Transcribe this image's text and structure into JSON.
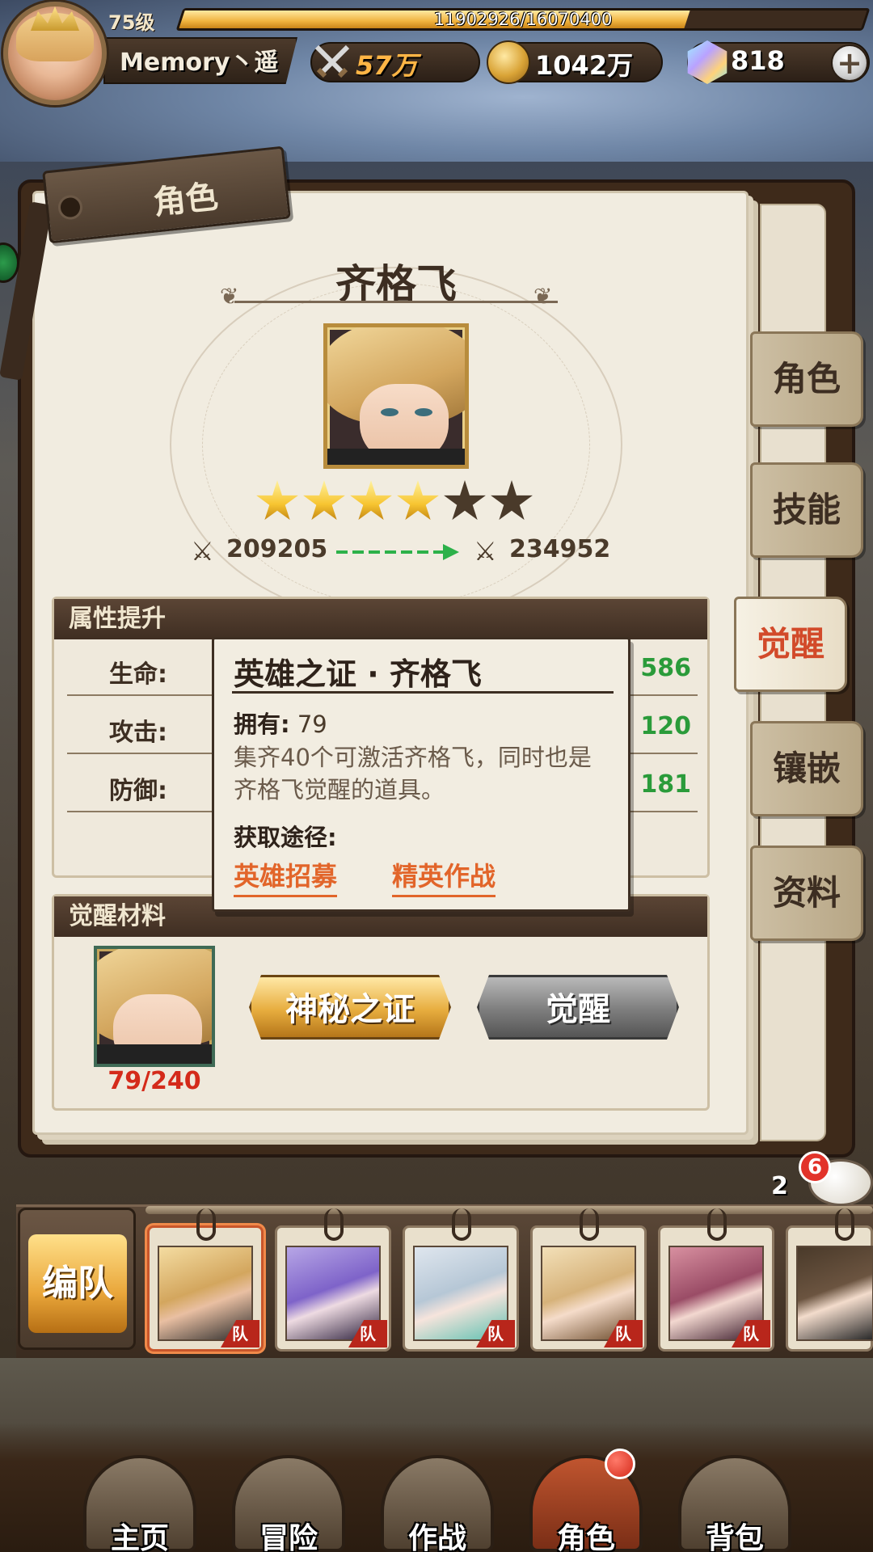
{
  "player": {
    "level": "75级",
    "exp_text": "11902926/16070400",
    "exp_fraction": 0.74,
    "name": "Memory丶遥"
  },
  "resources": {
    "power": "57万",
    "gold": "1042万",
    "gems": "818",
    "add": "+"
  },
  "panel": {
    "tag": "角色",
    "hero_name": "齐格飞",
    "stars_total": 6,
    "stars_filled": 4,
    "power_before": "209205",
    "power_after": "234952"
  },
  "attributes": {
    "title": "属性提升",
    "rows": [
      {
        "label": "生命:",
        "value": "586"
      },
      {
        "label": "攻击:",
        "value": "120"
      },
      {
        "label": "防御:",
        "value": "181"
      }
    ]
  },
  "materials": {
    "title": "觉醒材料",
    "count": "79/240",
    "mystery_button": "神秘之证",
    "awaken_button": "觉醒"
  },
  "side_tabs": [
    {
      "label": "角色"
    },
    {
      "label": "技能"
    },
    {
      "label": "觉醒"
    },
    {
      "label": "镶嵌"
    },
    {
      "label": "资料"
    }
  ],
  "tooltip": {
    "title": "英雄之证 · 齐格飞",
    "owned_label": "拥有:",
    "owned_value": "79",
    "description": "集齐40个可激活齐格飞，同时也是齐格飞觉醒的道具。",
    "source_label": "获取途径:",
    "source_links": [
      "英雄招募",
      "精英作战"
    ]
  },
  "team": {
    "button": "编队",
    "badge": "队",
    "chat_count": "2",
    "chat_badge": "6"
  },
  "nav": [
    {
      "label": "主页"
    },
    {
      "label": "冒险"
    },
    {
      "label": "作战"
    },
    {
      "label": "角色"
    },
    {
      "label": "背包"
    }
  ]
}
